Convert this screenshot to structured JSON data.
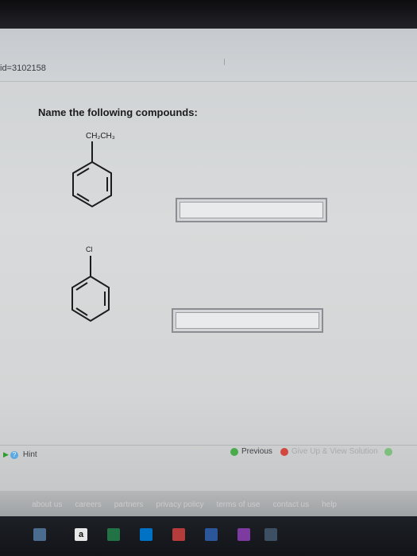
{
  "browser": {
    "url_fragment": "id=3102158"
  },
  "question": {
    "heading": "Name the following compounds:"
  },
  "compounds": [
    {
      "substituent": "CH₂CH₃",
      "answer": ""
    },
    {
      "substituent": "Cl",
      "answer": ""
    }
  ],
  "hint_bar": {
    "hint_label": "Hint",
    "previous_label": "Previous",
    "give_up_label": "Give Up & View Solution"
  },
  "footer": {
    "links": [
      "about us",
      "careers",
      "partners",
      "privacy policy",
      "terms of use",
      "contact us",
      "help"
    ]
  },
  "taskbar": {
    "icons": [
      "file-explorer-icon",
      "amazon-icon",
      "excel-icon",
      "outlook-icon",
      "photos-icon",
      "word-icon",
      "onenote-icon",
      "store-icon"
    ]
  }
}
